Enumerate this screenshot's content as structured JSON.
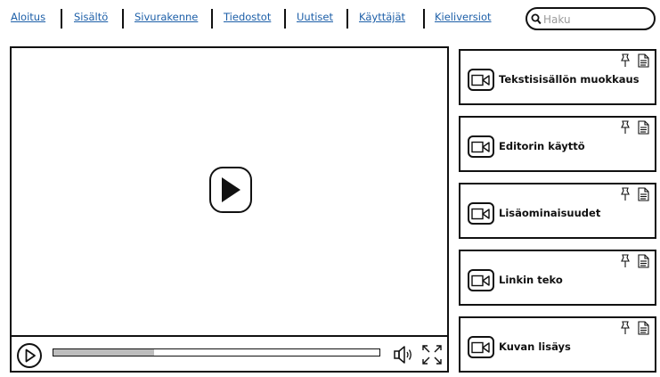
{
  "nav": {
    "links": [
      {
        "label": "Aloitus"
      },
      {
        "label": "Sisältö"
      },
      {
        "label": "Sivurakenne"
      },
      {
        "label": "Tiedostot"
      },
      {
        "label": "Uutiset"
      },
      {
        "label": "Käyttäjät"
      },
      {
        "label": "Kieliversiot"
      }
    ],
    "search": {
      "placeholder": "Haku",
      "value": "",
      "icon": "search-icon"
    }
  },
  "player": {
    "big_play_icon": "play-icon",
    "progress": 0.31,
    "controls": [
      "play-icon",
      "volume-icon",
      "fullscreen-icon"
    ]
  },
  "playlist": {
    "items": [
      {
        "title": "Tekstisisällön muokkaus",
        "thumb_icon": "video-camera-icon"
      },
      {
        "title": "Editorin käyttö",
        "thumb_icon": "video-camera-icon"
      },
      {
        "title": "Lisäominaisuudet",
        "thumb_icon": "video-camera-icon"
      },
      {
        "title": "Linkin teko",
        "thumb_icon": "video-camera-icon"
      },
      {
        "title": "Kuvan lisäys",
        "thumb_icon": "video-camera-icon"
      }
    ],
    "item_icons": [
      "pin-icon",
      "document-icon"
    ]
  },
  "colors": {
    "link": "#1d5fa8",
    "border": "#111111",
    "progress_fill": "#bdbdbd"
  }
}
